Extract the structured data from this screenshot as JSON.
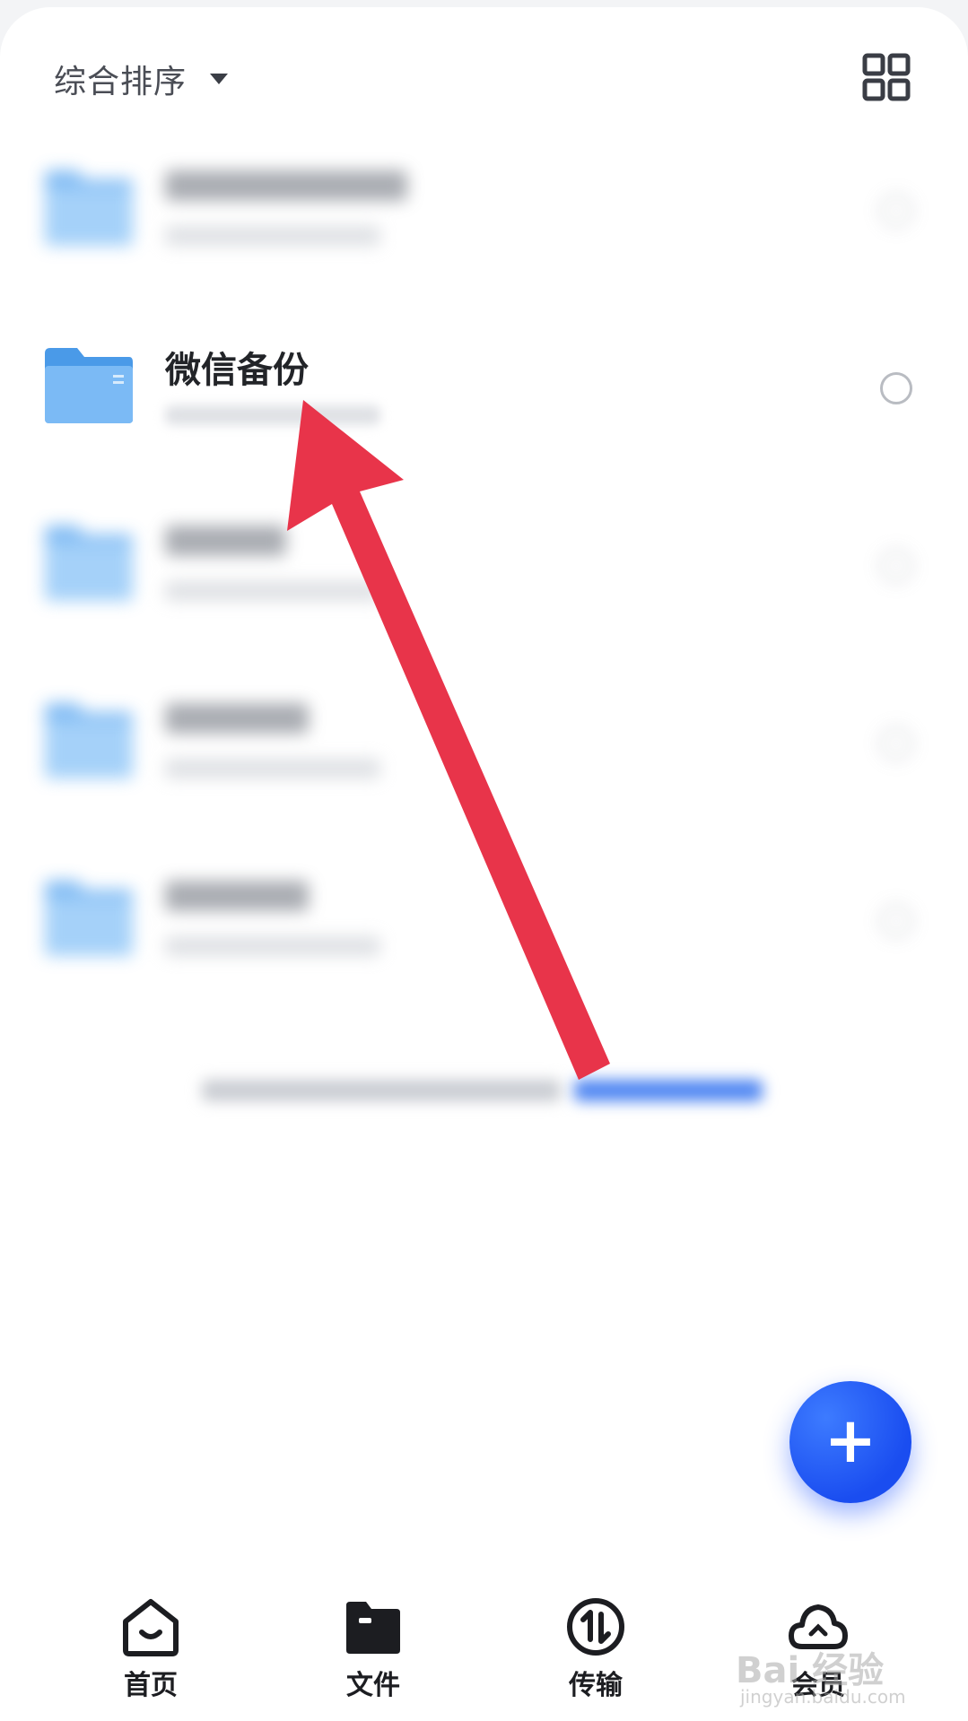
{
  "toolbar": {
    "sort_label": "综合排序",
    "sort_icon": "caret-down-icon",
    "view_toggle_icon": "grid-view-icon"
  },
  "files": [
    {
      "name": "",
      "meta": "",
      "blurred": true
    },
    {
      "name": "微信备份",
      "meta": "",
      "blurred": false
    },
    {
      "name": "",
      "meta": "",
      "blurred": true
    },
    {
      "name": "",
      "meta": "",
      "blurred": true
    },
    {
      "name": "",
      "meta": "",
      "blurred": true
    }
  ],
  "fab": {
    "label": "+",
    "icon": "plus-icon"
  },
  "nav": {
    "items": [
      {
        "label": "首页",
        "icon": "home-icon"
      },
      {
        "label": "文件",
        "icon": "folder-icon"
      },
      {
        "label": "传输",
        "icon": "transfer-icon"
      },
      {
        "label": "会员",
        "icon": "cloud-icon"
      }
    ]
  },
  "watermark": {
    "text": "Bai 经验",
    "sub": "jingyan.baidu.com"
  },
  "colors": {
    "accent": "#1f55f5",
    "folder": "#6fb3f3",
    "annotation_arrow": "#e8344a"
  }
}
